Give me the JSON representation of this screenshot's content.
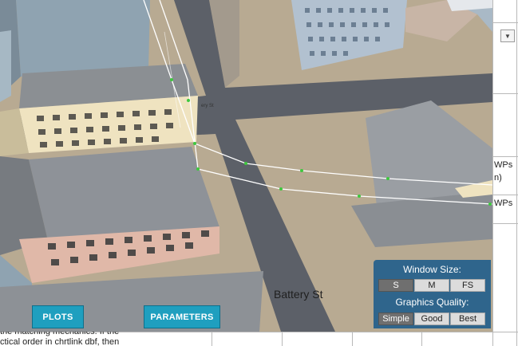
{
  "document": {
    "side_labels": [
      "WPs",
      "n)",
      "WPs"
    ],
    "dropdown_icon": "chevron-down-icon",
    "bottom_text": [
      "the matching mechanics. If the",
      "ctical order in chrtlink dbf, then"
    ]
  },
  "scene": {
    "street_label": "Battery St",
    "tiny_label": "ery St"
  },
  "buttons": {
    "plots": "PLOTS",
    "parameters": "PARAMETERS"
  },
  "settings_panel": {
    "window_size_label": "Window Size:",
    "window_size_options": [
      "S",
      "M",
      "FS"
    ],
    "window_size_selected": "S",
    "graphics_quality_label": "Graphics Quality:",
    "graphics_quality_options": [
      "Simple",
      "Good",
      "Best"
    ],
    "graphics_quality_selected": "Simple"
  },
  "colors": {
    "button_accent": "#1f9fbf",
    "panel_bg": "#235f8c",
    "path_line": "#ffffff",
    "waypoint": "#3ec83e"
  }
}
